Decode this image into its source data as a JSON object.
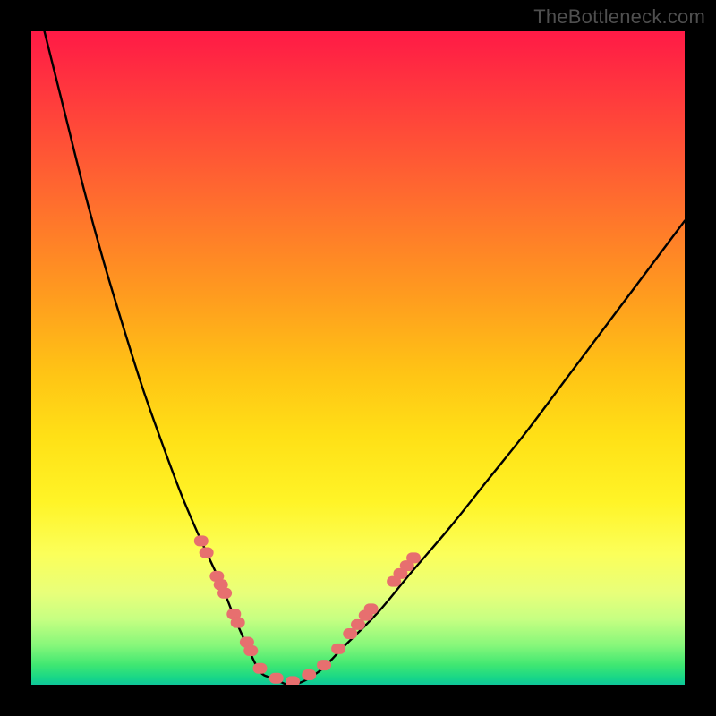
{
  "watermark": "TheBottleneck.com",
  "colors": {
    "page_bg": "#000000",
    "watermark_text": "#4f4f4f",
    "curve_stroke": "#000000",
    "dot_fill": "#e76f6f",
    "gradient_top": "#ff1a46",
    "gradient_bottom": "#0fc79a"
  },
  "chart_data": {
    "type": "line",
    "title": "",
    "xlabel": "",
    "ylabel": "",
    "xlim": [
      0,
      100
    ],
    "ylim": [
      0,
      100
    ],
    "legend": false,
    "grid": false,
    "description": "V-shaped bottleneck / mismatch curve on a red-to-green heat gradient. Descent is steep on the left, ascent is gentler on the right; minimum is near x≈35 at y≈0. Pink dot markers highlight segments of the curve near the bottom of the V.",
    "series": [
      {
        "name": "bottleneck-curve",
        "x": [
          2,
          5,
          8,
          11,
          14,
          17,
          20,
          23,
          26,
          29,
          31,
          33,
          35,
          37,
          40,
          44,
          48,
          53,
          58,
          64,
          70,
          76,
          82,
          88,
          94,
          100
        ],
        "y": [
          100,
          88,
          76,
          65,
          55,
          45.5,
          37,
          29,
          22,
          15.5,
          10.5,
          6,
          2,
          1,
          0,
          2,
          6,
          11,
          17,
          24,
          31.5,
          39,
          47,
          55,
          63,
          71
        ]
      }
    ],
    "markers": [
      {
        "x": 26.0,
        "y": 22.0
      },
      {
        "x": 26.8,
        "y": 20.2
      },
      {
        "x": 28.4,
        "y": 16.6
      },
      {
        "x": 29.0,
        "y": 15.3
      },
      {
        "x": 29.6,
        "y": 14.0
      },
      {
        "x": 31.0,
        "y": 10.8
      },
      {
        "x": 31.6,
        "y": 9.5
      },
      {
        "x": 33.0,
        "y": 6.5
      },
      {
        "x": 33.6,
        "y": 5.2
      },
      {
        "x": 35.0,
        "y": 2.5
      },
      {
        "x": 37.5,
        "y": 1.0
      },
      {
        "x": 40.0,
        "y": 0.5
      },
      {
        "x": 42.5,
        "y": 1.5
      },
      {
        "x": 44.8,
        "y": 3.0
      },
      {
        "x": 47.0,
        "y": 5.5
      },
      {
        "x": 48.8,
        "y": 7.8
      },
      {
        "x": 50.0,
        "y": 9.2
      },
      {
        "x": 51.2,
        "y": 10.6
      },
      {
        "x": 52.0,
        "y": 11.6
      },
      {
        "x": 55.5,
        "y": 15.8
      },
      {
        "x": 56.5,
        "y": 17.0
      },
      {
        "x": 57.5,
        "y": 18.2
      },
      {
        "x": 58.5,
        "y": 19.4
      }
    ]
  }
}
